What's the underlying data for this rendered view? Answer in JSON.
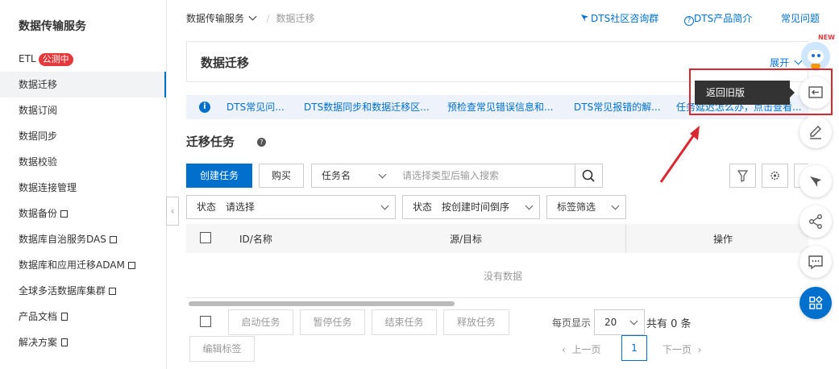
{
  "sidebar": {
    "title": "数据传输服务",
    "items": [
      {
        "label": "ETL",
        "badge": "公测中"
      },
      {
        "label": "数据迁移"
      },
      {
        "label": "数据订阅"
      },
      {
        "label": "数据同步"
      },
      {
        "label": "数据校验"
      },
      {
        "label": "数据连接管理"
      },
      {
        "label": "数据备份"
      },
      {
        "label": "数据库自治服务DAS"
      },
      {
        "label": "数据库和应用迁移ADAM"
      },
      {
        "label": "全球多活数据库集群"
      },
      {
        "label": "产品文档"
      },
      {
        "label": "解决方案"
      }
    ],
    "active_item": "数据迁移"
  },
  "header": {
    "breadcrumb_root": "数据传输服务",
    "breadcrumb_sep": "/",
    "breadcrumb_current": "数据迁移",
    "links": [
      "DTS社区咨询群",
      "DTS产品简介",
      "常见问题"
    ]
  },
  "title_box": {
    "title": "数据迁移",
    "expand": "展开"
  },
  "info_bar": {
    "icon": "info-icon",
    "links": [
      "DTS常见问...",
      "DTS数据同步和数据迁移区...",
      "预检查常见错误信息和...",
      "DTS常见报错的解...",
      "任务延迟怎么办，点击查看..."
    ]
  },
  "section": {
    "title": "迁移任务"
  },
  "toolbar": {
    "create_label": "创建任务",
    "buy_label": "购买",
    "search_field": "任务名",
    "search_placeholder": "请选择类型后输入搜索"
  },
  "filters": {
    "status_label": "状态",
    "status_value": "请选择",
    "sort_label": "状态",
    "sort_value": "按创建时间倒序",
    "tag_filter": "标签筛选"
  },
  "table": {
    "columns": [
      "ID/名称",
      "源/目标",
      "操作"
    ],
    "empty": "没有数据"
  },
  "footer": {
    "actions": [
      "启动任务",
      "暂停任务",
      "结束任务",
      "释放任务"
    ],
    "edit_tags": "编辑标签",
    "page_size_label": "每页显示",
    "page_size": "20",
    "total": "共有 0 条",
    "prev": "上一页",
    "next": "下一页",
    "current_page": "1"
  },
  "float_bar": {
    "new_tag": "NEW",
    "tooltip": "返回旧版",
    "icons": [
      "return-old-version-icon",
      "edit-icon",
      "megaphone-icon",
      "share-icon",
      "chat-icon",
      "apps-icon"
    ]
  },
  "colors": {
    "accent": "#0070cc",
    "badge": "#e4393c",
    "highlight_box": "#d9282f"
  }
}
